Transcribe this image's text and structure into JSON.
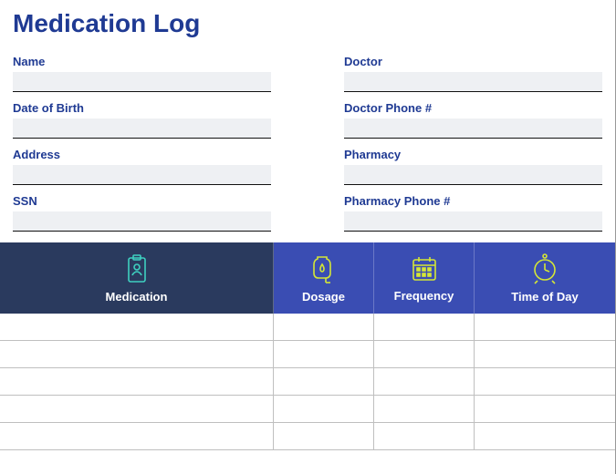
{
  "title": "Medication Log",
  "colors": {
    "heading": "#1f3a93",
    "header_dark": "#2a3a5e",
    "header_blue": "#3a4db3",
    "icon_primary": "#d4e636",
    "icon_accent": "#3ed0c0"
  },
  "fields": {
    "left": [
      {
        "label": "Name",
        "value": ""
      },
      {
        "label": "Date of Birth",
        "value": ""
      },
      {
        "label": "Address",
        "value": ""
      },
      {
        "label": "SSN",
        "value": ""
      }
    ],
    "right": [
      {
        "label": "Doctor",
        "value": ""
      },
      {
        "label": "Doctor Phone #",
        "value": ""
      },
      {
        "label": "Pharmacy",
        "value": ""
      },
      {
        "label": "Pharmacy Phone #",
        "value": ""
      }
    ]
  },
  "table": {
    "columns": [
      {
        "label": "Medication",
        "icon": "clipboard-id-icon"
      },
      {
        "label": "Dosage",
        "icon": "iv-bag-icon"
      },
      {
        "label": "Frequency",
        "icon": "calendar-icon"
      },
      {
        "label": "Time of Day",
        "icon": "clock-icon"
      }
    ],
    "rows": [
      {
        "medication": "",
        "dosage": "",
        "frequency": "",
        "time_of_day": ""
      },
      {
        "medication": "",
        "dosage": "",
        "frequency": "",
        "time_of_day": ""
      },
      {
        "medication": "",
        "dosage": "",
        "frequency": "",
        "time_of_day": ""
      },
      {
        "medication": "",
        "dosage": "",
        "frequency": "",
        "time_of_day": ""
      },
      {
        "medication": "",
        "dosage": "",
        "frequency": "",
        "time_of_day": ""
      }
    ]
  }
}
